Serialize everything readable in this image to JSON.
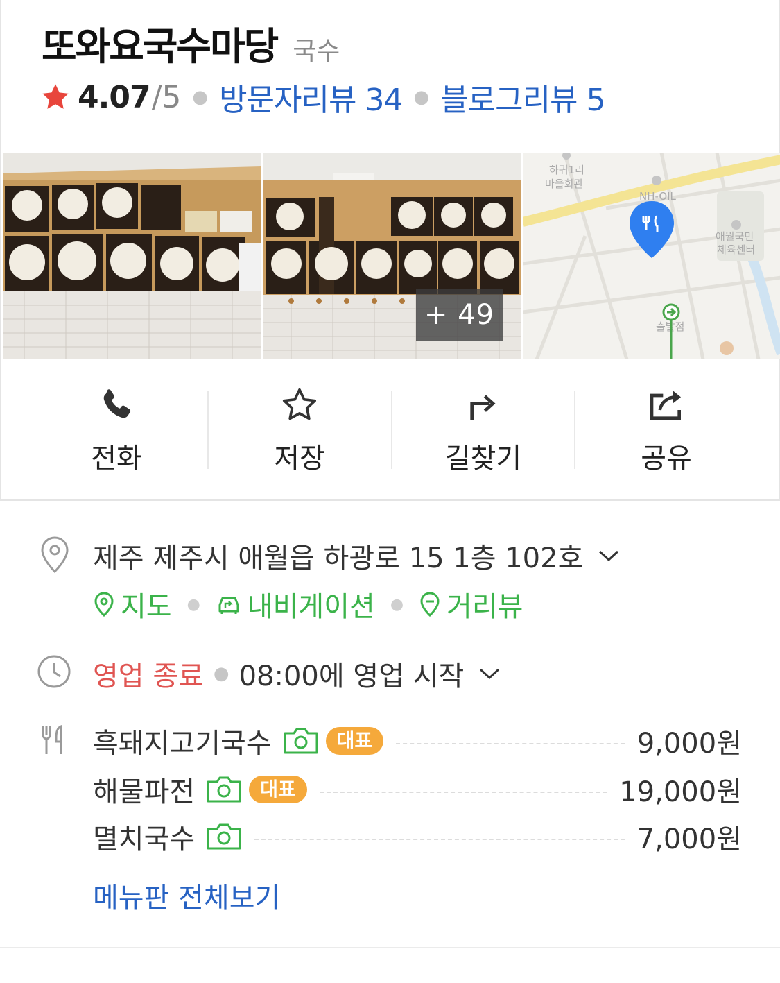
{
  "place": {
    "name": "또와요국수마당",
    "category": "국수",
    "rating": "4.07",
    "rating_max": "/5",
    "visitor_reviews": "방문자리뷰 34",
    "blog_reviews": "블로그리뷰 5"
  },
  "photos": {
    "more_count": "+ 49",
    "map_labels": [
      "하귀1리\n마을회관",
      "NH-OIL",
      "애월국민\n체육센터",
      "출발점"
    ]
  },
  "actions": [
    {
      "label": "전화",
      "icon": "phone-icon"
    },
    {
      "label": "저장",
      "icon": "star-outline-icon"
    },
    {
      "label": "길찾기",
      "icon": "directions-icon"
    },
    {
      "label": "공유",
      "icon": "share-icon"
    }
  ],
  "address": {
    "text": "제주 제주시 애월읍 하광로 15 1층 102호",
    "links": [
      "지도",
      "내비게이션",
      "거리뷰"
    ]
  },
  "hours": {
    "status": "영업 종료",
    "next": "08:00에 영업 시작"
  },
  "menu": {
    "items": [
      {
        "name": "흑돼지고기국수",
        "badge": "대표",
        "price": "9,000원"
      },
      {
        "name": "해물파전",
        "badge": "대표",
        "price": "19,000원"
      },
      {
        "name": "멸치국수",
        "badge": "",
        "price": "7,000원"
      }
    ],
    "view_all": "메뉴판 전체보기"
  },
  "colors": {
    "rating_star": "#e8453c",
    "link_blue": "#2762c3",
    "nav_green": "#3bb34a",
    "closed_red": "#e05552",
    "badge_orange": "#f5a93b",
    "map_pin": "#2f7ff0"
  }
}
